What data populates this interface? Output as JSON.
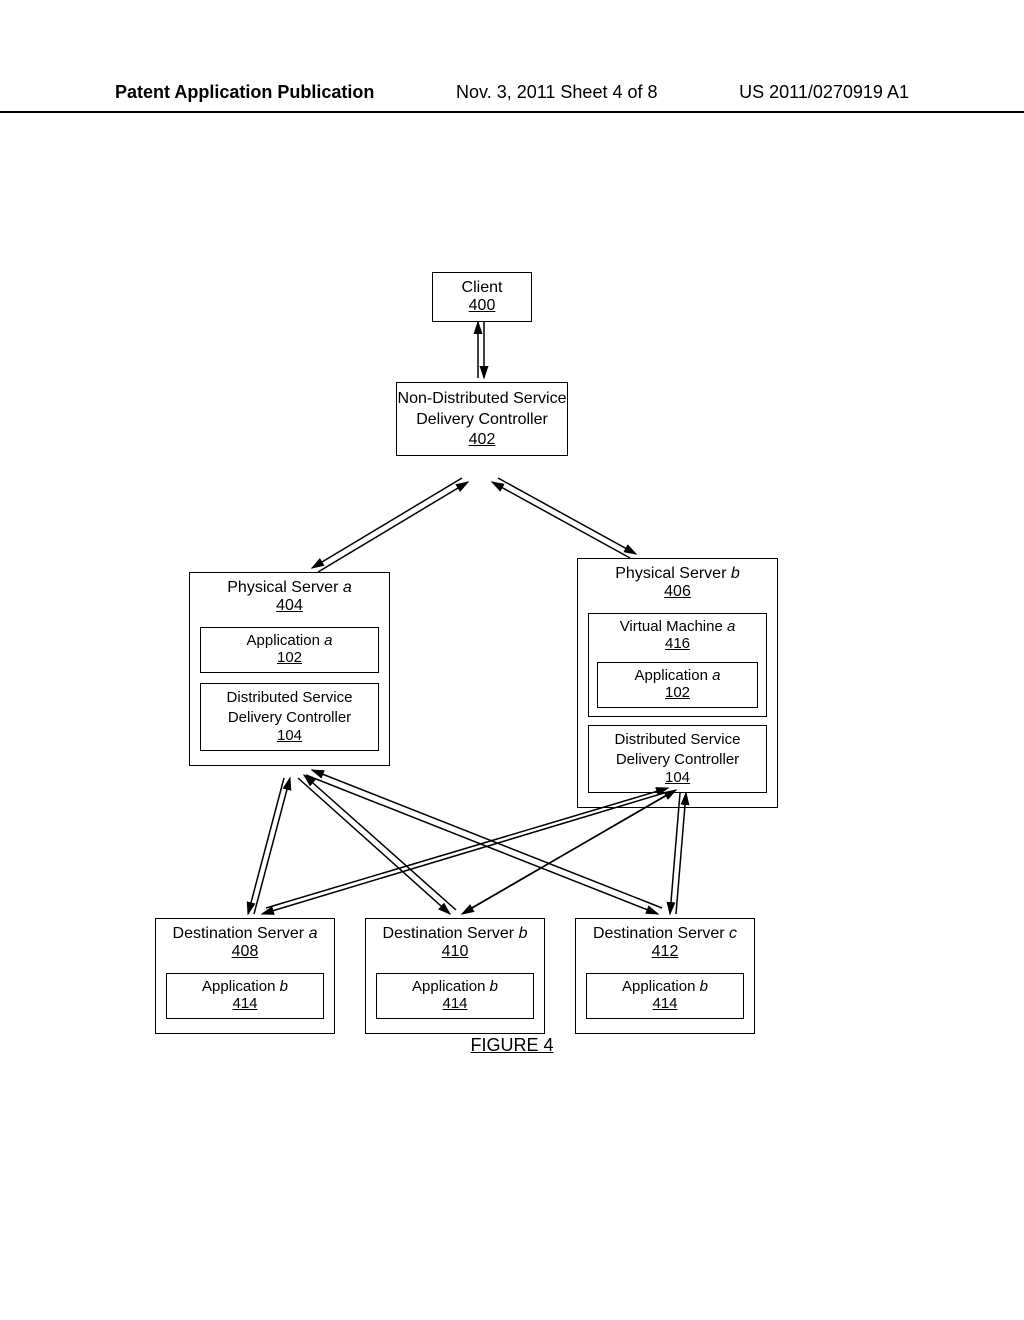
{
  "header": {
    "left": "Patent Application Publication",
    "middle": "Nov. 3, 2011   Sheet 4 of 8",
    "right": "US 2011/0270919 A1"
  },
  "client": {
    "label": "Client",
    "ref": "400"
  },
  "ndsc": {
    "label": "Non-Distributed Service Delivery Controller",
    "ref": "402"
  },
  "serverA": {
    "label_prefix": "Physical Server ",
    "label_suffix": "a",
    "ref": "404",
    "app": {
      "label_prefix": "Application ",
      "label_suffix": "a",
      "ref": "102"
    },
    "dsc": {
      "label": "Distributed Service Delivery Controller",
      "ref": "104"
    }
  },
  "serverB": {
    "label_prefix": "Physical Server ",
    "label_suffix": "b",
    "ref": "406",
    "vm": {
      "label_prefix": "Virtual Machine ",
      "label_suffix": "a",
      "ref": "416"
    },
    "app": {
      "label_prefix": "Application ",
      "label_suffix": "a",
      "ref": "102"
    },
    "dsc": {
      "label": "Distributed Service Delivery Controller",
      "ref": "104"
    }
  },
  "destA": {
    "label_prefix": "Destination Server ",
    "label_suffix": "a",
    "ref": "408",
    "app": {
      "label_prefix": "Application ",
      "label_suffix": "b",
      "ref": "414"
    }
  },
  "destB": {
    "label_prefix": "Destination Server ",
    "label_suffix": "b",
    "ref": "410",
    "app": {
      "label_prefix": "Application ",
      "label_suffix": "b",
      "ref": "414"
    }
  },
  "destC": {
    "label_prefix": "Destination Server ",
    "label_suffix": "c",
    "ref": "412",
    "app": {
      "label_prefix": "Application ",
      "label_suffix": "b",
      "ref": "414"
    }
  },
  "figure": "FIGURE 4"
}
